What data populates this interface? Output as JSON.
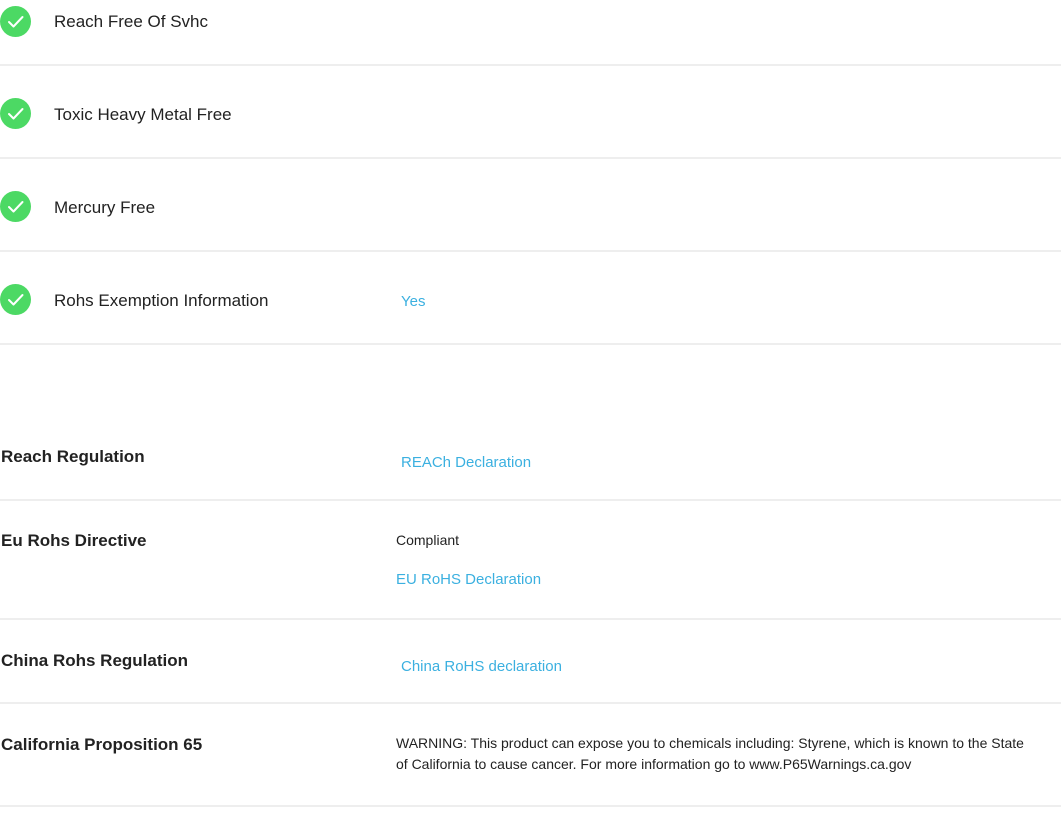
{
  "checklist": [
    {
      "label": "Reach Free Of Svhc",
      "value": "",
      "icon": "check-circle-icon",
      "icon_color": "#4cd964"
    },
    {
      "label": "Toxic Heavy Metal Free",
      "value": "",
      "icon": "check-circle-icon",
      "icon_color": "#4cd964"
    },
    {
      "label": "Mercury Free",
      "value": "",
      "icon": "check-circle-icon",
      "icon_color": "#4cd964"
    },
    {
      "label": "Rohs Exemption Information",
      "value": "Yes",
      "icon": "check-circle-icon",
      "icon_color": "#4cd964"
    }
  ],
  "regulations": [
    {
      "label": "Reach Regulation",
      "status": "",
      "link": "REACh Declaration"
    },
    {
      "label": "Eu Rohs Directive",
      "status": "Compliant",
      "link": "EU RoHS Declaration"
    },
    {
      "label": "China Rohs Regulation",
      "status": "",
      "link": "China RoHS declaration"
    },
    {
      "label": "California Proposition 65",
      "status": "WARNING: This product can expose you to chemicals including: Styrene, which is known to the State of California to cause cancer. For more information go to www.P65Warnings.ca.gov",
      "link": ""
    }
  ],
  "colors": {
    "link": "#3bb0e0",
    "check": "#4cd964",
    "divider": "#eeeeee"
  }
}
